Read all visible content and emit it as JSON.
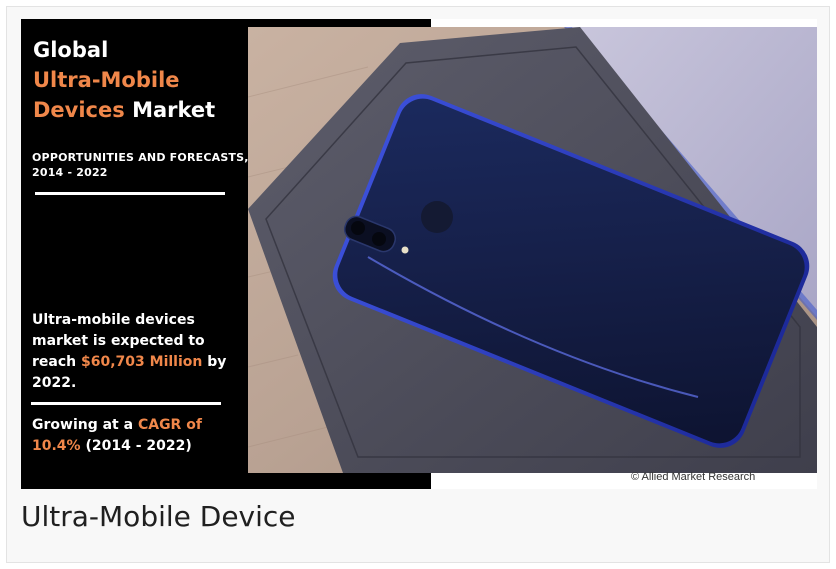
{
  "infographic": {
    "title": {
      "line1": "Global",
      "line2_accent": "Ultra-Mobile",
      "line3_accent": "Devices",
      "line3_rest": " Market"
    },
    "subtitle": {
      "line1": "OPPORTUNITIES AND FORECASTS,",
      "line2": "2014 - 2022"
    },
    "stat": {
      "line1": "Ultra-mobile devices",
      "line2": "market is expected to",
      "line3_pre": "reach ",
      "line3_accent": "$60,703 Million",
      "line3_post": " by",
      "line4": "2022."
    },
    "growth": {
      "line1_pre": "Growing at a ",
      "line1_accent": "CAGR of",
      "line2_accent": "10.4%",
      "line2_post": " (2014 - 2022)"
    },
    "accent_color": "#f0874a",
    "photo_subject": "smartphone-on-notebook-photo"
  },
  "credit": "© Allied Market Research",
  "caption": "Ultra-Mobile Device"
}
